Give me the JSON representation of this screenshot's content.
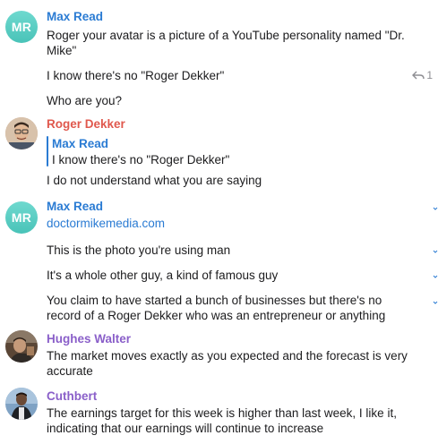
{
  "messages": {
    "g1": {
      "avatar_initials": "MR",
      "sender": "Max Read",
      "sender_color": "#2a7bd3",
      "line1": "Roger your avatar is a picture of a YouTube personality named \"Dr.",
      "line2": "Mike\"",
      "line3": "I know there's no \"Roger Dekker\"",
      "reply_count": "1",
      "line4": "Who are you?"
    },
    "g2": {
      "sender": "Roger Dekker",
      "sender_color": "#e0584d",
      "reply_name": "Max Read",
      "reply_text": "I know there's no \"Roger Dekker\"",
      "line1": "I do not understand what you are saying"
    },
    "g3": {
      "avatar_initials": "MR",
      "sender": "Max Read",
      "sender_color": "#2a7bd3",
      "link": "doctormikemedia.com",
      "line1": "This is the photo you're using man",
      "line2": "It's a whole other guy, a kind of famous guy",
      "line3": "You claim to have started a bunch of businesses but there's no",
      "line4": "record of a Roger Dekker who was an entrepreneur or anything"
    },
    "g4": {
      "sender": "Hughes Walter",
      "sender_color": "#8a5fc9",
      "line1": "The market moves exactly as you expected and the forecast is very",
      "line2": "accurate"
    },
    "g5": {
      "sender": "Cuthbert",
      "sender_color": "#8a5fc9",
      "line1": "The earnings target for this week is higher than last week, I like it,",
      "line2": "indicating that our earnings will continue to increase"
    }
  },
  "icons": {
    "reply": "reply-arrow-icon",
    "edge": "chevron-icon"
  }
}
